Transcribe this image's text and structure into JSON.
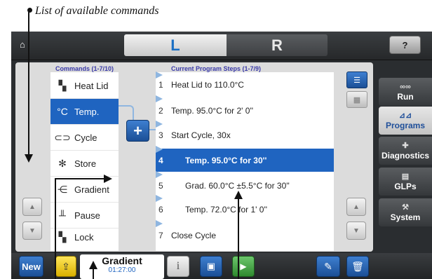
{
  "caption": "List of available commands",
  "top_tabs": [
    "L",
    "R"
  ],
  "help_label": "?",
  "commands": {
    "header": "Commands (1-7/10)",
    "items": [
      {
        "label": "Heat Lid",
        "icon": "heat-lid-icon",
        "glyph": "▚"
      },
      {
        "label": "Temp.",
        "icon": "temperature-icon",
        "glyph": "°C"
      },
      {
        "label": "Cycle",
        "icon": "cycle-icon",
        "glyph": "⊂⊃"
      },
      {
        "label": "Store",
        "icon": "snowflake-icon",
        "glyph": "✻"
      },
      {
        "label": "Gradient",
        "icon": "gradient-icon",
        "glyph": "⋲"
      },
      {
        "label": "Pause",
        "icon": "pause-icon",
        "glyph": "╨"
      },
      {
        "label": "Lock",
        "icon": "lock-icon",
        "glyph": "▚"
      }
    ],
    "selected_index": 1
  },
  "steps": {
    "header": "Current Program Steps (1-7/9)",
    "items": [
      {
        "num": "1",
        "text": "Heat Lid to 110.0°C"
      },
      {
        "num": "2",
        "text": "Temp.  95.0°C for 2' 0''"
      },
      {
        "num": "3",
        "text": "Start Cycle, 30x"
      },
      {
        "num": "4",
        "text": "Temp.  95.0°C for 30''"
      },
      {
        "num": "5",
        "text": "Grad.  60.0°C ±5.5°C  for 30''"
      },
      {
        "num": "6",
        "text": "Temp.  72.0°C for 1' 0''"
      },
      {
        "num": "7",
        "text": "Close Cycle"
      }
    ],
    "selected_index": 3
  },
  "add_label": "+",
  "nav": [
    {
      "label": "Run",
      "icon": "dna-icon",
      "glyph": "∞∞"
    },
    {
      "label": "Programs",
      "icon": "programs-icon",
      "glyph": "⊿⊿"
    },
    {
      "label": "Diagnostics",
      "icon": "medkit-icon",
      "glyph": "✚"
    },
    {
      "label": "GLPs",
      "icon": "document-icon",
      "glyph": "▤"
    },
    {
      "label": "System",
      "icon": "wrench-icon",
      "glyph": "⚒"
    }
  ],
  "nav_selected": "Programs",
  "toolbar": {
    "new_label": "New",
    "program_name": "Gradient",
    "program_time": "01:27:00"
  },
  "colors": {
    "accent_blue": "#1f64c0",
    "frame_dark": "#2a2d30",
    "panel_gray": "#dcdcdc"
  }
}
